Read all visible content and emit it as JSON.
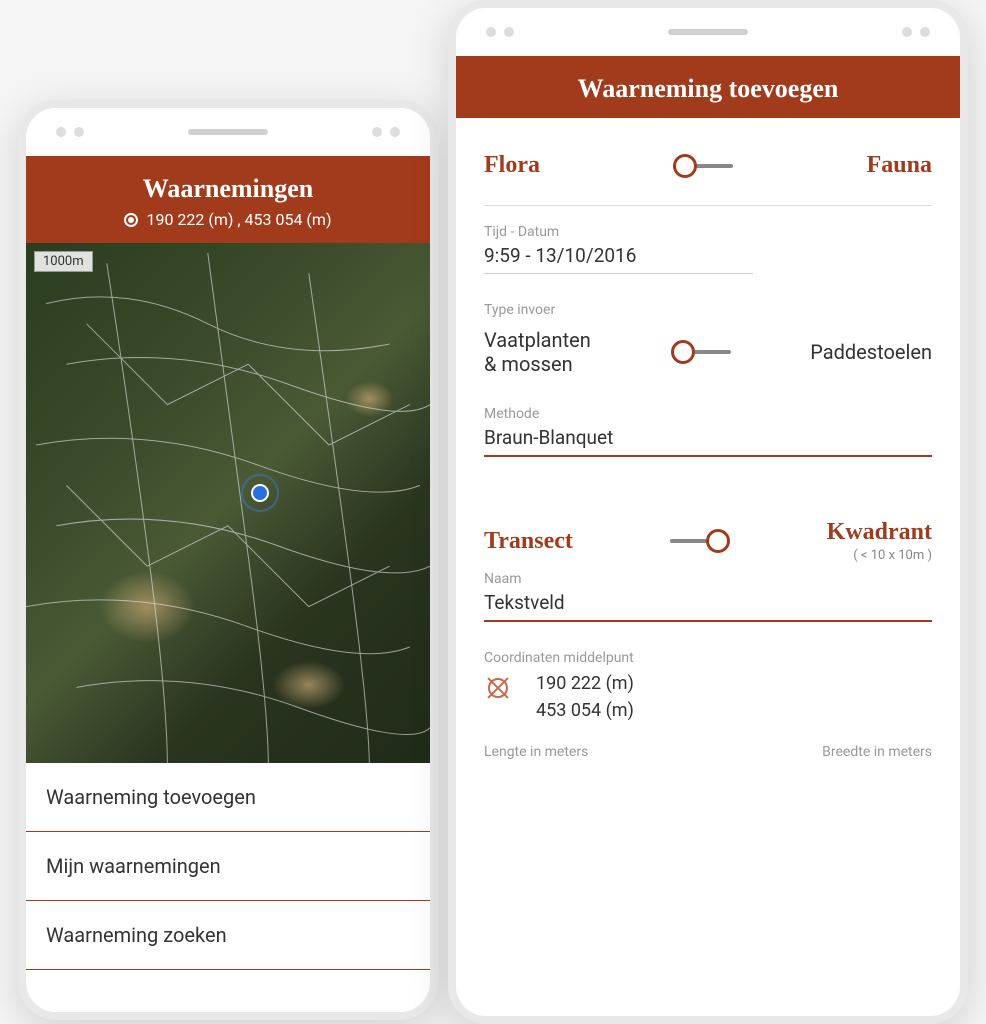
{
  "colors": {
    "accent": "#a23b1c"
  },
  "left": {
    "title": "Waarnemingen",
    "coords": "190 222 (m) , 453 054 (m)",
    "scale": "1000m",
    "menu": [
      "Waarneming toevoegen",
      "Mijn waarnemingen",
      "Waarneming zoeken"
    ]
  },
  "right": {
    "title": "Waarneming toevoegen",
    "toggle1": {
      "left": "Flora",
      "right": "Fauna",
      "position": "left"
    },
    "datetime": {
      "label": "Tijd - Datum",
      "value": "9:59 - 13/10/2016"
    },
    "typeInvoer": {
      "label": "Type invoer",
      "left": "Vaatplanten\n& mossen",
      "right": "Paddestoelen",
      "position": "left"
    },
    "methode": {
      "label": "Methode",
      "value": "Braun-Blanquet"
    },
    "toggle2": {
      "left": "Transect",
      "right": "Kwadrant",
      "sub": "( < 10 x 10m )",
      "position": "right"
    },
    "naam": {
      "label": "Naam",
      "value": "Tekstveld"
    },
    "coords": {
      "label": "Coordinaten middelpunt",
      "x": "190 222 (m)",
      "y": "453 054 (m)"
    },
    "dims": {
      "lengte": "Lengte in meters",
      "breedte": "Breedte in meters"
    }
  }
}
